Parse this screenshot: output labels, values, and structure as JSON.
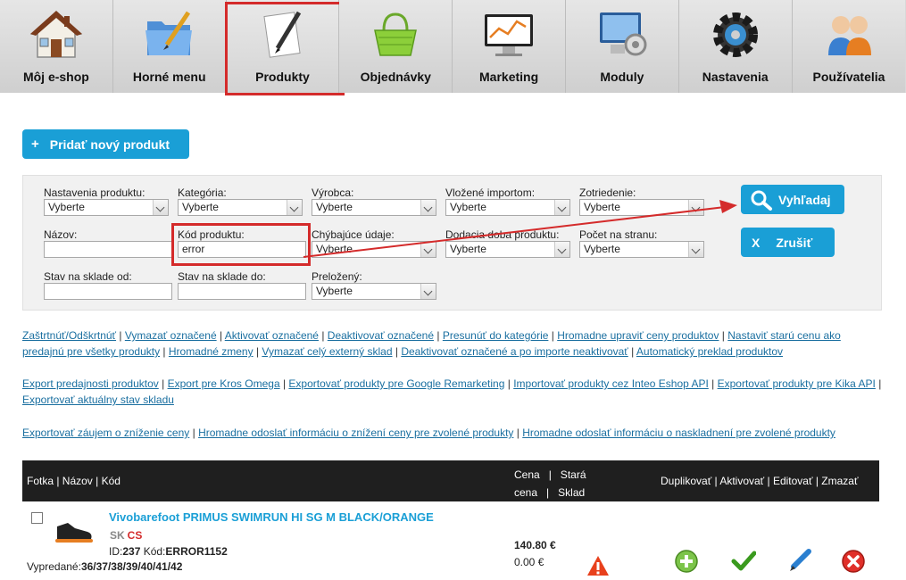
{
  "nav": [
    {
      "label": "Môj e-shop",
      "icon": "house-icon"
    },
    {
      "label": "Horné menu",
      "icon": "folder-pen-icon"
    },
    {
      "label": "Produkty",
      "icon": "paper-pen-icon"
    },
    {
      "label": "Objednávky",
      "icon": "basket-icon"
    },
    {
      "label": "Marketing",
      "icon": "monitor-chart-icon"
    },
    {
      "label": "Moduly",
      "icon": "monitor-gear-icon"
    },
    {
      "label": "Nastavenia",
      "icon": "gear-icon"
    },
    {
      "label": "Používatelia",
      "icon": "users-icon"
    }
  ],
  "add_button": {
    "plus": "+",
    "label": "Pridať nový produkt"
  },
  "filters": {
    "product_settings": {
      "label": "Nastavenia produktu:",
      "value": "Vyberte"
    },
    "category": {
      "label": "Kategória:",
      "value": "Vyberte"
    },
    "manufacturer": {
      "label": "Výrobca:",
      "value": "Vyberte"
    },
    "imported": {
      "label": "Vložené importom:",
      "value": "Vyberte"
    },
    "sorting": {
      "label": "Zotriedenie:",
      "value": "Vyberte"
    },
    "name": {
      "label": "Názov:",
      "value": ""
    },
    "code": {
      "label": "Kód produktu:",
      "value": "error"
    },
    "missing": {
      "label": "Chýbajúce údaje:",
      "value": "Vyberte"
    },
    "delivery": {
      "label": "Dodacia doba produktu:",
      "value": "Vyberte"
    },
    "per_page": {
      "label": "Počet na stranu:",
      "value": "Vyberte"
    },
    "stock_from": {
      "label": "Stav na sklade od:",
      "value": ""
    },
    "stock_to": {
      "label": "Stav na sklade do:",
      "value": ""
    },
    "translated": {
      "label": "Preložený:",
      "value": "Vyberte"
    }
  },
  "search_button": {
    "label": "Vyhľadaj"
  },
  "cancel_button": {
    "x": "X",
    "label": "Zrušiť"
  },
  "links1": [
    "Zaštrtnúť/Odškrtnúť",
    "Vymazať označené",
    "Aktivovať označené",
    "Deaktivovať označené",
    "Presunúť do kategórie",
    "Hromadne upraviť ceny produktov",
    "Nastaviť starú cenu ako predajnú pre všetky produkty",
    "Hromadné zmeny",
    "Vymazať celý externý sklad",
    "Deaktivovať označené a po importe neaktivovať",
    "Automatický preklad produktov"
  ],
  "links2": [
    "Export predajnosti produktov",
    "Export pre Kros Omega",
    "Exportovať produkty pre Google Remarketing",
    "Importovať produkty cez Inteo Eshop API",
    "Exportovať produkty pre Kika API",
    "Exportovať aktuálny stav skladu"
  ],
  "links3": [
    "Exportovať záujem o zníženie ceny",
    "Hromadne odoslať informáciu o znížení ceny pre zvolené produkty",
    "Hromadne odoslať informáciu o naskladnení pre zvolené produkty"
  ],
  "table": {
    "col_main": "Fotka | Názov | Kód",
    "col_price": "Cena   |   Stará\ncena   |   Sklad",
    "col_actions": "Duplikovať | Aktivovať | Editovať | Zmazať"
  },
  "product": {
    "name": "Vivobarefoot PRIMUS SWIMRUN HI SG M BLACK/ORANGE",
    "lang1": "SK",
    "lang2": "CS",
    "id_label": "ID:",
    "id": "237",
    "code_label": " Kód:",
    "code": "ERROR1152",
    "sold_label": "Vypredané:",
    "sold": "36/37/38/39/40/41/42",
    "price": "140.80 €",
    "old_price": "0.00 €"
  },
  "colors": {
    "accent": "#1a9fd6",
    "highlight": "#d42b2b",
    "header_bg": "#1f1f1f"
  }
}
